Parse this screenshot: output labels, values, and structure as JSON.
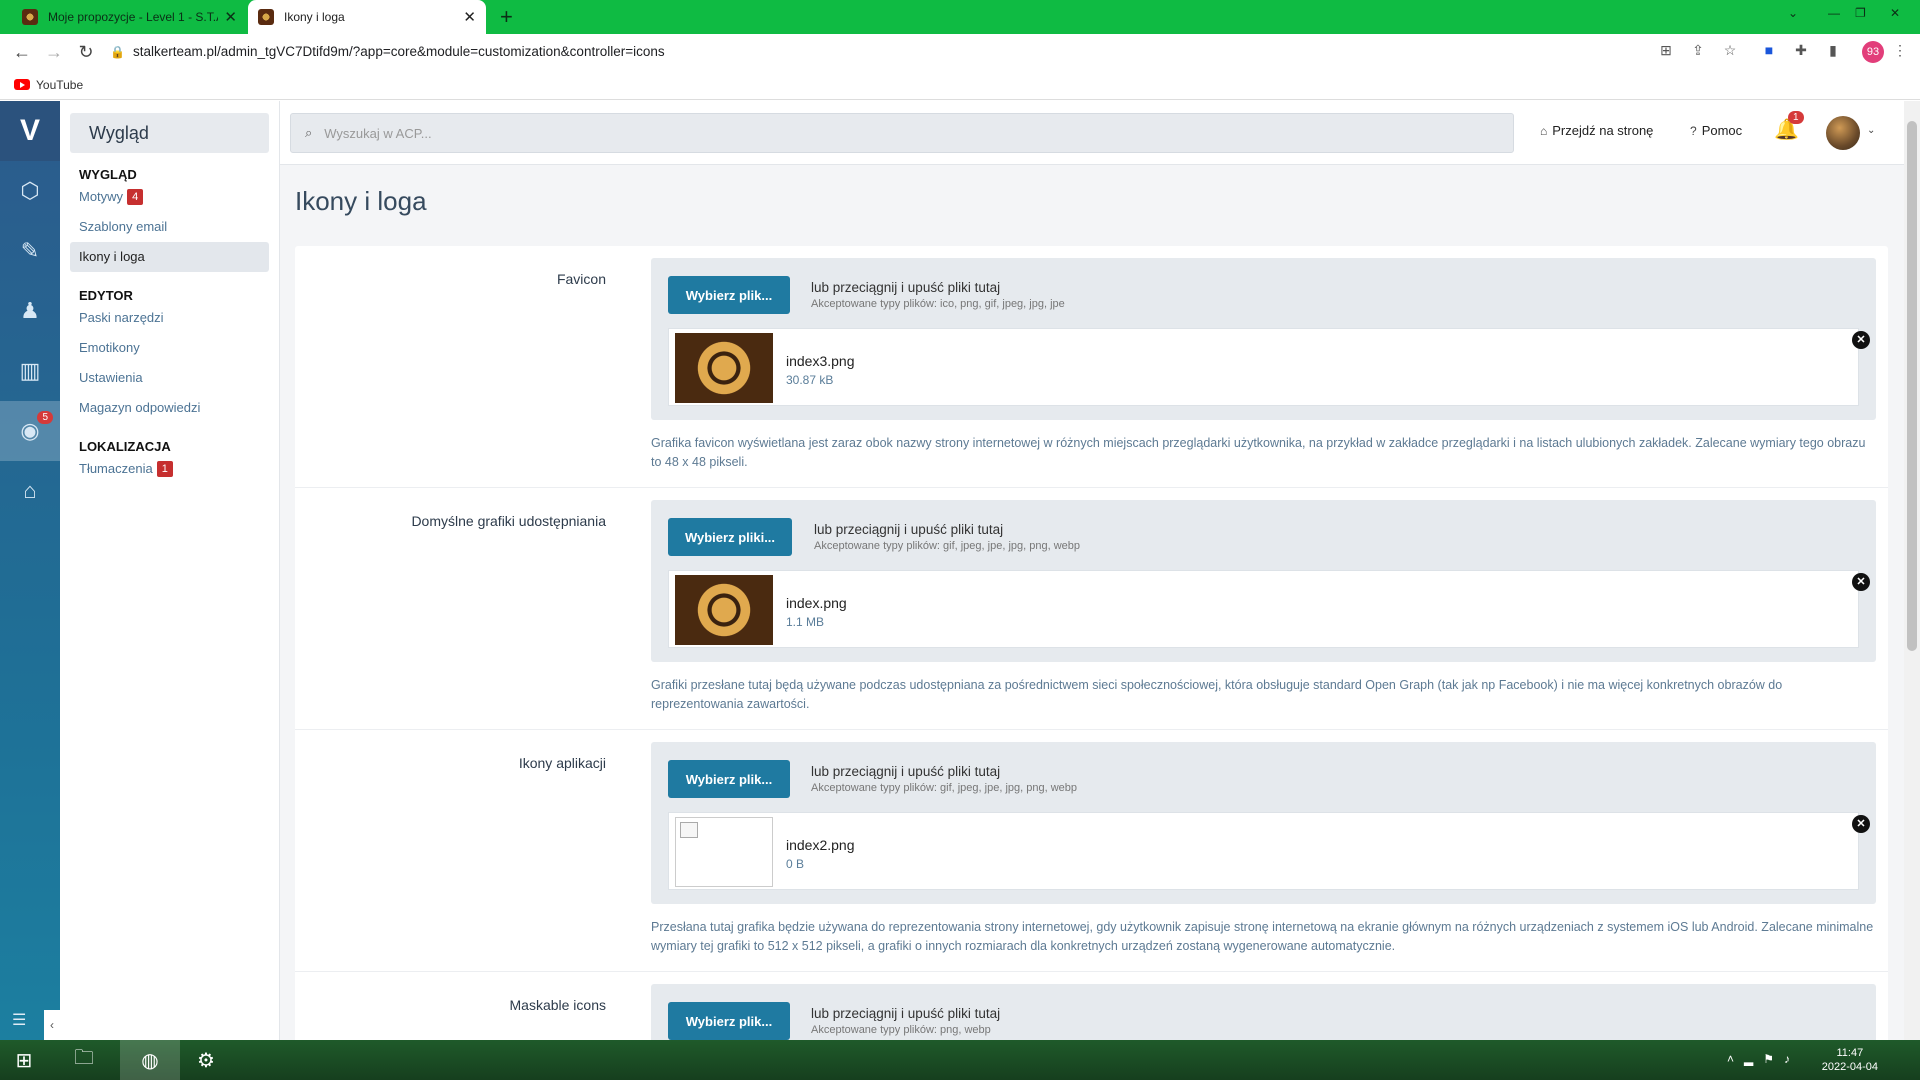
{
  "browser": {
    "tabs": [
      {
        "title": "Moje propozycje - Level 1 - S.T.A",
        "active": false
      },
      {
        "title": "Ikony i loga",
        "active": true
      }
    ],
    "url": "stalkerteam.pl/admin_tgVC7Dtifd9m/?app=core&module=customization&controller=icons",
    "profile_badge": "93",
    "bookmarks": [
      {
        "label": "YouTube",
        "icon": "youtube-icon"
      }
    ]
  },
  "rail": {
    "items": [
      {
        "name": "cube-icon"
      },
      {
        "name": "edit-icon"
      },
      {
        "name": "members-icon"
      },
      {
        "name": "stats-icon"
      },
      {
        "name": "eye-icon",
        "badge": "5",
        "active": true
      },
      {
        "name": "basket-icon"
      }
    ]
  },
  "subnav": {
    "title": "Wygląd",
    "groups": [
      {
        "label": "WYGLĄD",
        "items": [
          {
            "label": "Motywy",
            "badge": "4"
          },
          {
            "label": "Szablony email"
          },
          {
            "label": "Ikony i loga",
            "active": true
          }
        ]
      },
      {
        "label": "EDYTOR",
        "items": [
          {
            "label": "Paski narzędzi"
          },
          {
            "label": "Emotikony"
          },
          {
            "label": "Ustawienia"
          },
          {
            "label": "Magazyn odpowiedzi"
          }
        ]
      },
      {
        "label": "LOKALIZACJA",
        "items": [
          {
            "label": "Tłumaczenia",
            "badge": "1"
          }
        ]
      }
    ]
  },
  "topbar": {
    "search_placeholder": "Wyszukaj w ACP...",
    "visit_site": "Przejdź na stronę",
    "help": "Pomoc",
    "notifications": "1"
  },
  "page": {
    "title": "Ikony i loga",
    "upload_button": "Wybierz pliki...",
    "upload_button_single": "Wybierz plik...",
    "drag_text": "lub przeciągnij i upuść pliki tutaj",
    "fields": [
      {
        "label": "Favicon",
        "button": "Wybierz plik...",
        "types": "Akceptowane typy plików: ico, png, gif, jpeg, jpg, jpe",
        "file": {
          "name": "index3.png",
          "size": "30.87 kB"
        },
        "description": "Grafika favicon wyświetlana jest zaraz obok nazwy strony internetowej w różnych miejscach przeglądarki użytkownika, na przykład w zakładce przeglądarki i na listach ulubionych zakładek. Zalecane wymiary tego obrazu to 48 x 48 pikseli."
      },
      {
        "label": "Domyślne grafiki udostępniania",
        "button": "Wybierz pliki...",
        "types": "Akceptowane typy plików: gif, jpeg, jpe, jpg, png, webp",
        "file": {
          "name": "index.png",
          "size": "1.1 MB"
        },
        "description": "Grafiki przesłane tutaj będą używane podczas udostępniana za pośrednictwem sieci społecznościowej, która obsługuje standard Open Graph (tak jak np Facebook) i nie ma więcej konkretnych obrazów do reprezentowania zawartości."
      },
      {
        "label": "Ikony aplikacji",
        "button": "Wybierz plik...",
        "types": "Akceptowane typy plików: gif, jpeg, jpe, jpg, png, webp",
        "file": {
          "name": "index2.png",
          "size": "0 B"
        },
        "description": "Przesłana tutaj grafika będzie używana do reprezentowania strony internetowej, gdy użytkownik zapisuje stronę internetową na ekranie głównym na różnych urządzeniach z systemem iOS lub Android. Zalecane minimalne wymiary tej grafiki to 512 x 512 pikseli, a grafiki o innych rozmiarach dla konkretnych urządzeń zostaną wygenerowane automatycznie."
      },
      {
        "label": "Maskable icons",
        "button": "Wybierz plik...",
        "types": "Akceptowane typy plików: png, webp"
      }
    ]
  },
  "taskbar": {
    "time": "11:47",
    "date": "2022-04-04"
  }
}
